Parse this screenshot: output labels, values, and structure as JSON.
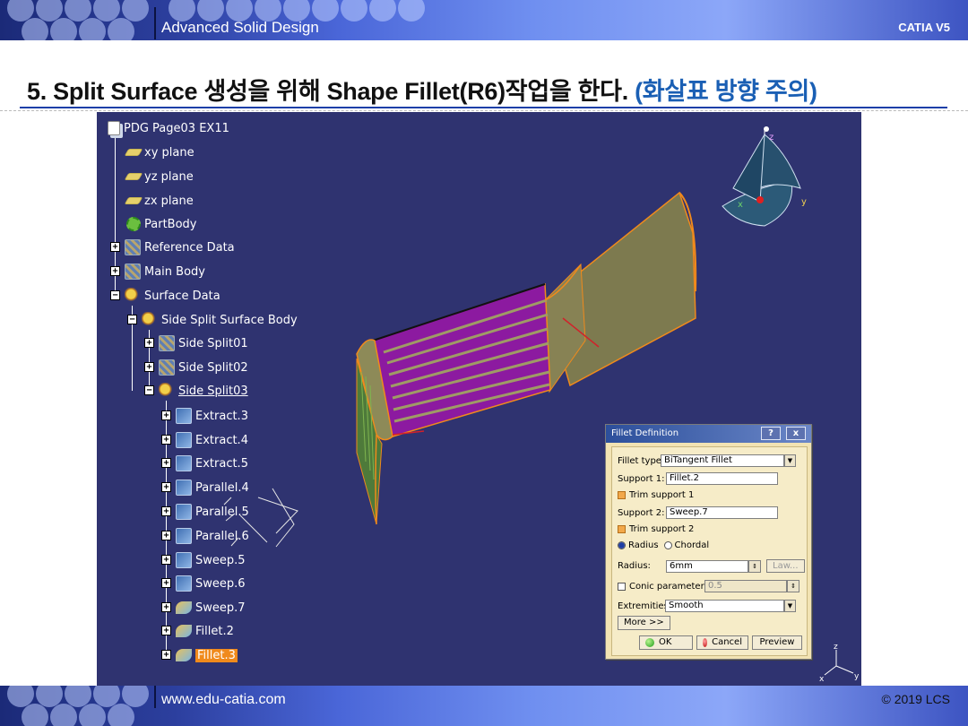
{
  "header": {
    "title": "Advanced Solid Design",
    "product": "CATIA V5"
  },
  "heading": {
    "main": "5. Split Surface 생성을 위해 Shape Fillet(R6)작업을 한다.",
    "note": "(화살표 방향 주의)"
  },
  "footer": {
    "site": "www.edu-catia.com",
    "copyright": "© 2019 LCS"
  },
  "tree": {
    "root": "PDG Page03 EX11",
    "items": [
      {
        "label": "xy plane"
      },
      {
        "label": "yz plane"
      },
      {
        "label": "zx plane"
      },
      {
        "label": "PartBody"
      },
      {
        "label": "Reference Data"
      },
      {
        "label": "Main Body"
      },
      {
        "label": "Surface Data"
      },
      {
        "label": "Side Split Surface Body"
      },
      {
        "label": "Side Split01"
      },
      {
        "label": "Side Split02"
      },
      {
        "label": "Side Split03"
      },
      {
        "label": "Extract.3"
      },
      {
        "label": "Extract.4"
      },
      {
        "label": "Extract.5"
      },
      {
        "label": "Parallel.4"
      },
      {
        "label": "Parallel.5"
      },
      {
        "label": "Parallel.6"
      },
      {
        "label": "Sweep.5"
      },
      {
        "label": "Sweep.6"
      },
      {
        "label": "Sweep.7"
      },
      {
        "label": "Fillet.2"
      },
      {
        "label": "Fillet.3"
      }
    ]
  },
  "compass": {
    "z": "z",
    "x": "x",
    "y": "y"
  },
  "axis_small": {
    "z": "z",
    "x": "x",
    "y": "y"
  },
  "dialog": {
    "title": "Fillet Definition",
    "help_btn": "?",
    "close_btn": "x",
    "fillet_type_label": "Fillet type:",
    "fillet_type_value": "BiTangent Fillet",
    "support1_label": "Support 1:",
    "support1_value": "Fillet.2",
    "trim1_label": "Trim support 1",
    "support2_label": "Support 2:",
    "support2_value": "Sweep.7",
    "trim2_label": "Trim support 2",
    "radius_option": "Radius",
    "chordal_option": "Chordal",
    "radius_label": "Radius:",
    "radius_value": "6mm",
    "law_btn": "Law...",
    "conic_label": "Conic parameter:",
    "conic_value": "0.5",
    "extremities_label": "Extremities:",
    "extremities_value": "Smooth",
    "more_btn": "More >>",
    "ok_btn": "OK",
    "cancel_btn": "Cancel",
    "preview_btn": "Preview"
  },
  "colors": {
    "viewport_bg": "#2f3370",
    "dialog_bg": "#f2e3b3",
    "surface_olive": "#7d7a4f",
    "surface_magenta": "#8c1aa0",
    "edge_orange": "#f08a1c",
    "heading_blue": "#1a5fb4"
  }
}
